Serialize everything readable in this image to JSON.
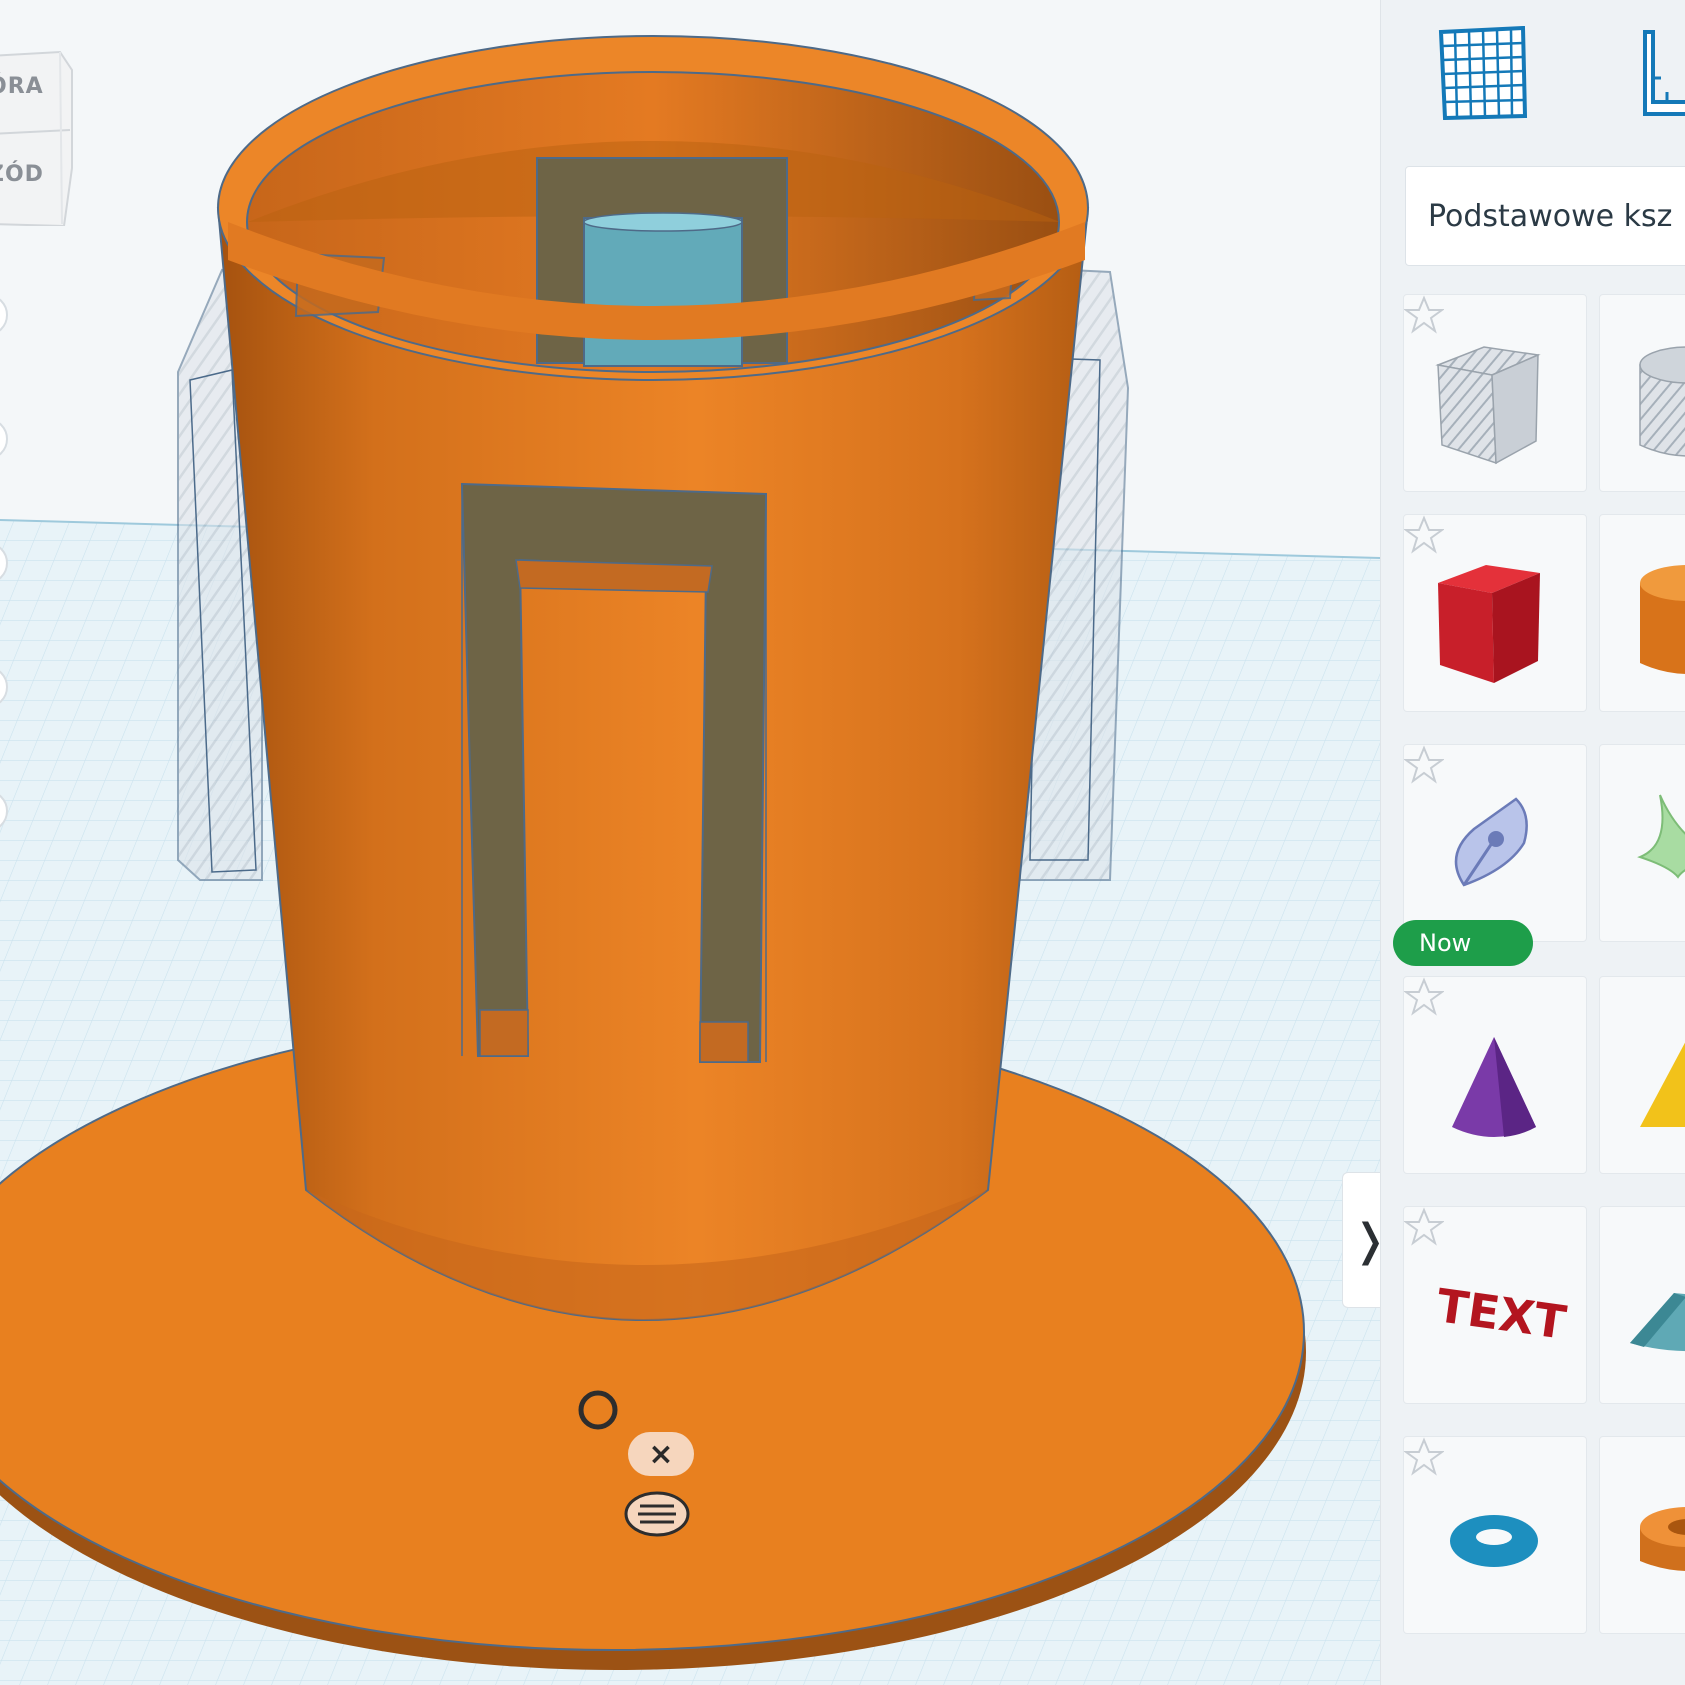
{
  "viewport": {
    "viewcube": {
      "top_label": "ÓRA",
      "front_label": "ZÓD"
    },
    "object_toolbar": {
      "close_symbol": "×"
    },
    "expand_panel_symbol": "❭"
  },
  "panel": {
    "category_label": "Podstawowe ksz",
    "new_badge": "Now",
    "shapes": [
      {
        "name": "box-hole",
        "icon": "striped-cube-icon"
      },
      {
        "name": "cylinder-hole",
        "icon": "striped-cylinder-icon"
      },
      {
        "name": "box",
        "icon": "red-cube-icon"
      },
      {
        "name": "cylinder",
        "icon": "orange-cylinder-icon"
      },
      {
        "name": "scribble",
        "icon": "scribble-pen-icon"
      },
      {
        "name": "shape-generator",
        "icon": "green-shape-icon"
      },
      {
        "name": "cone",
        "icon": "purple-cone-icon"
      },
      {
        "name": "pyramid",
        "icon": "yellow-pyramid-icon"
      },
      {
        "name": "text",
        "icon": "red-text-icon",
        "text": "TEXT"
      },
      {
        "name": "roof",
        "icon": "teal-roof-icon"
      },
      {
        "name": "torus",
        "icon": "blue-torus-icon"
      },
      {
        "name": "tube",
        "icon": "orange-tube-icon"
      }
    ]
  },
  "colors": {
    "accent": "#1479b8",
    "object_orange": "#e77c22",
    "workplane": "#e8f3f8",
    "grid_line": "#bcd9e6",
    "new_badge": "#1e9e4a"
  }
}
